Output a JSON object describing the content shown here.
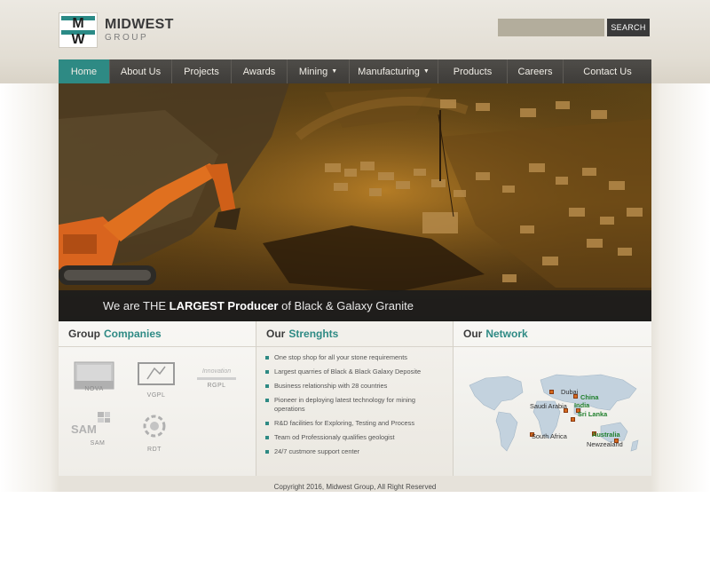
{
  "brand": {
    "logo_letter_top": "M",
    "logo_letter_bottom": "W",
    "name": "MIDWEST",
    "sub": "GROUP",
    "accent_color": "#2e8a84"
  },
  "search": {
    "placeholder": "",
    "value": "",
    "button_label": "SEARCH"
  },
  "nav": {
    "items": [
      {
        "label": "Home",
        "active": true
      },
      {
        "label": "About Us"
      },
      {
        "label": "Projects"
      },
      {
        "label": "Awards"
      },
      {
        "label": "Mining",
        "dropdown": true
      },
      {
        "label": "Manufacturing",
        "dropdown": true
      },
      {
        "label": "Products"
      },
      {
        "label": "Careers"
      },
      {
        "label": "Contact Us"
      }
    ],
    "caret": "▼"
  },
  "hero": {
    "caption_pre": "We are THE ",
    "caption_bold": "LARGEST Producer",
    "caption_post": " of Black & Galaxy Granite"
  },
  "companies": {
    "title_plain": "Group",
    "title_accent": "Companies",
    "items": [
      {
        "label": "NOVA",
        "icon": "nova-logo-icon"
      },
      {
        "label": "VGPL",
        "icon": "vgpl-logo-icon"
      },
      {
        "label": "RGPL",
        "icon": "rgpl-logo-icon",
        "mark_text": "Innovation"
      },
      {
        "label": "SAM",
        "icon": "sam-logo-icon",
        "mark_text": "SAM"
      },
      {
        "label": "RDT",
        "icon": "rdt-logo-icon"
      }
    ]
  },
  "strengths": {
    "title_plain": "Our",
    "title_accent": "Strenghts",
    "items": [
      "One stop shop for all your stone requirements",
      "Largest quarries of Black & Black Galaxy Deposite",
      "Business relationship with 28 countries",
      "Pioneer in deploying latest technology for mining operations",
      "R&D facilities for Exploring, Testing and Process",
      "Team od Professionaly qualifies geologist",
      "24/7 custmore support center"
    ]
  },
  "network": {
    "title_plain": "Our",
    "title_accent": "Network",
    "locations": [
      {
        "label": "Dubai",
        "highlight": false
      },
      {
        "label": "China",
        "highlight": true
      },
      {
        "label": "Saudi Arabia",
        "highlight": false
      },
      {
        "label": "India",
        "highlight": true
      },
      {
        "label": "Sri Lanka",
        "highlight": true
      },
      {
        "label": "South Africa",
        "highlight": false
      },
      {
        "label": "Australia",
        "highlight": true
      },
      {
        "label": "Newzealand",
        "highlight": false
      }
    ]
  },
  "footer": {
    "copyright": "Copyright 2016, Midwest Group, All Right Reserved"
  }
}
